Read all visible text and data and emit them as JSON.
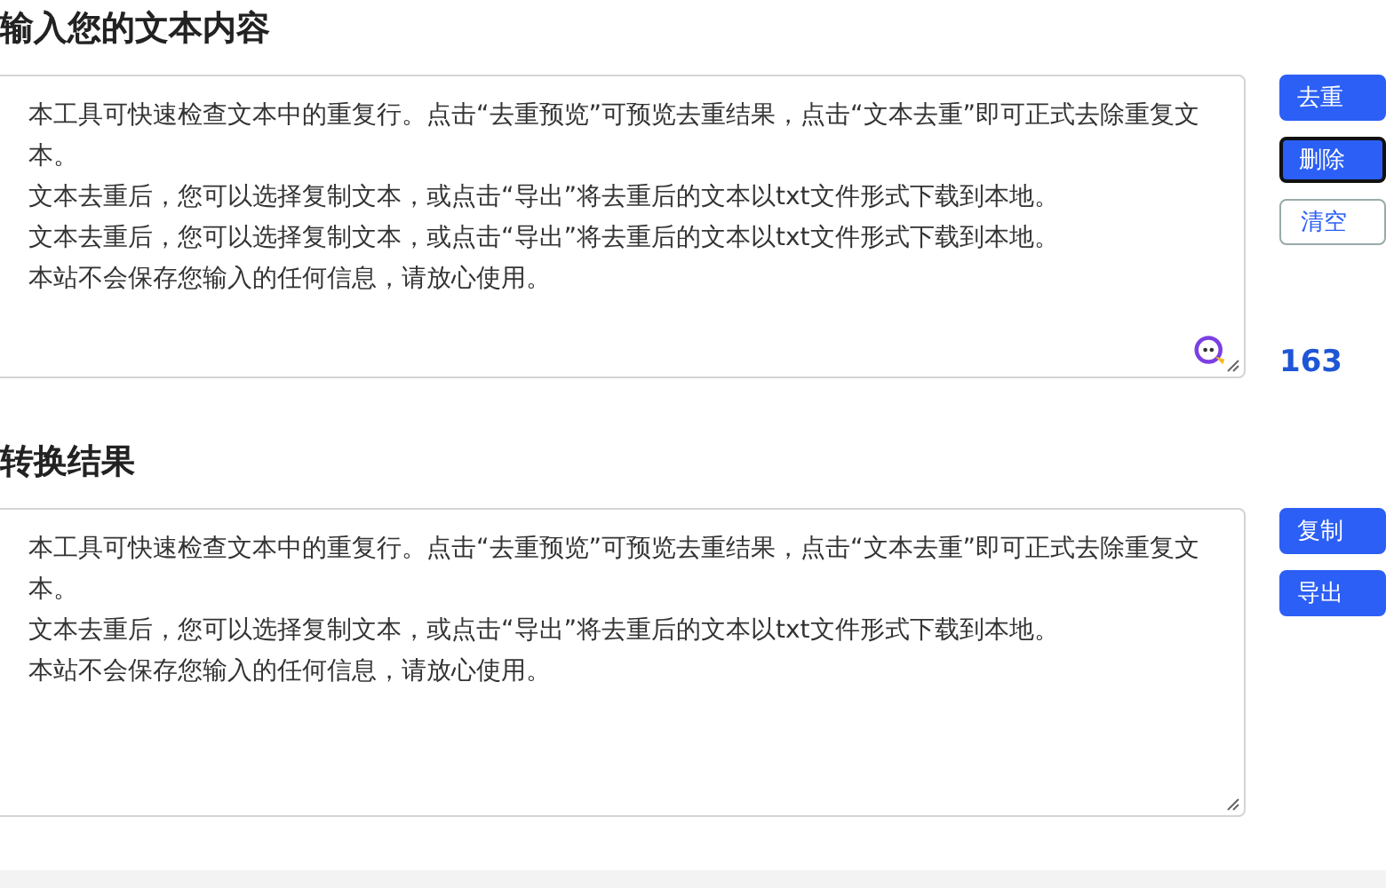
{
  "input_section": {
    "heading": "输入您的文本内容",
    "paragraphs": [
      "本工具可快速检查文本中的重复行。点击“去重预览”可预览去重结果，点击“文本去重”即可正式去除重复文本。",
      "文本去重后，您可以选择复制文本，或点击“导出”将去重后的文本以txt文件形式下载到本地。",
      "文本去重后，您可以选择复制文本，或点击“导出”将去重后的文本以txt文件形式下载到本地。",
      "本站不会保存您输入的任何信息，请放心使用。"
    ],
    "buttons": [
      {
        "label": "去重",
        "kind": "primary",
        "focused": false
      },
      {
        "label": "删除",
        "kind": "primary",
        "focused": true
      },
      {
        "label": "清空",
        "kind": "outline",
        "focused": false
      }
    ],
    "char_count": "163"
  },
  "result_section": {
    "heading": "转换结果",
    "paragraphs": [
      "本工具可快速检查文本中的重复行。点击“去重预览”可预览去重结果，点击“文本去重”即可正式去除重复文本。",
      "文本去重后，您可以选择复制文本，或点击“导出”将去重后的文本以txt文件形式下载到本地。",
      "本站不会保存您输入的任何信息，请放心使用。"
    ],
    "buttons": [
      {
        "label": "复制",
        "focused": false
      },
      {
        "label": "导出",
        "focused": false
      }
    ]
  }
}
